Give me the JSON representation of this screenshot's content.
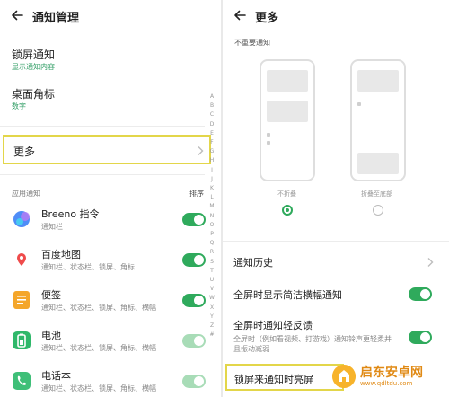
{
  "left": {
    "header": {
      "title": "通知管理"
    },
    "lockscreen": {
      "title": "锁屏通知",
      "subtitle": "显示通知内容"
    },
    "badge": {
      "title": "桌面角标",
      "subtitle": "数字"
    },
    "more": {
      "label": "更多"
    },
    "apps_section": {
      "label": "应用通知",
      "sort_label": "排序"
    },
    "alphabet": [
      "A",
      "B",
      "C",
      "D",
      "E",
      "F",
      "G",
      "H",
      "I",
      "J",
      "K",
      "L",
      "M",
      "N",
      "O",
      "P",
      "Q",
      "R",
      "S",
      "T",
      "U",
      "V",
      "W",
      "X",
      "Y",
      "Z",
      "#"
    ],
    "apps": [
      {
        "name": "Breeno 指令",
        "sub": "通知栏",
        "enabled": true,
        "icon": "breeno-icon",
        "color": "#3d7df6"
      },
      {
        "name": "百度地图",
        "sub": "通知栏、状态栏、锁屏、角标",
        "enabled": true,
        "icon": "map-pin-icon",
        "color": "#ef4b4b"
      },
      {
        "name": "便签",
        "sub": "通知栏、状态栏、锁屏、角标、横幅",
        "enabled": true,
        "icon": "notes-icon",
        "color": "#f4a62a"
      },
      {
        "name": "电池",
        "sub": "通知栏、状态栏、锁屏、角标、横幅",
        "enabled": true,
        "icon": "battery-icon",
        "color": "#2fb86a"
      },
      {
        "name": "电话本",
        "sub": "通知栏、状态栏、锁屏、角标、横幅",
        "enabled": true,
        "icon": "phonebook-icon",
        "color": "#3fbf78"
      }
    ]
  },
  "right": {
    "header": {
      "title": "更多"
    },
    "unimportant": {
      "label": "不重要通知"
    },
    "options": [
      {
        "caption": "不折叠",
        "selected": true
      },
      {
        "caption": "折叠至底部",
        "selected": false
      }
    ],
    "history": {
      "title": "通知历史"
    },
    "fullscreen_banner": {
      "title": "全屏时显示简洁横幅通知",
      "enabled": true
    },
    "fullscreen_feedback": {
      "title": "全屏时通知轻反馈",
      "subtitle": "全屏时（例如看视频、打游戏）通知铃声更轻柔并且振动减弱",
      "enabled": true
    },
    "lock_wake": {
      "title": "锁屏来通知时亮屏"
    }
  },
  "watermark": {
    "title": "启东安卓网",
    "url": "www.qdltdu.com"
  },
  "colors": {
    "accent": "#2faa5c",
    "highlight": "#e3d64a",
    "subtitle_green": "#2e9c63"
  }
}
